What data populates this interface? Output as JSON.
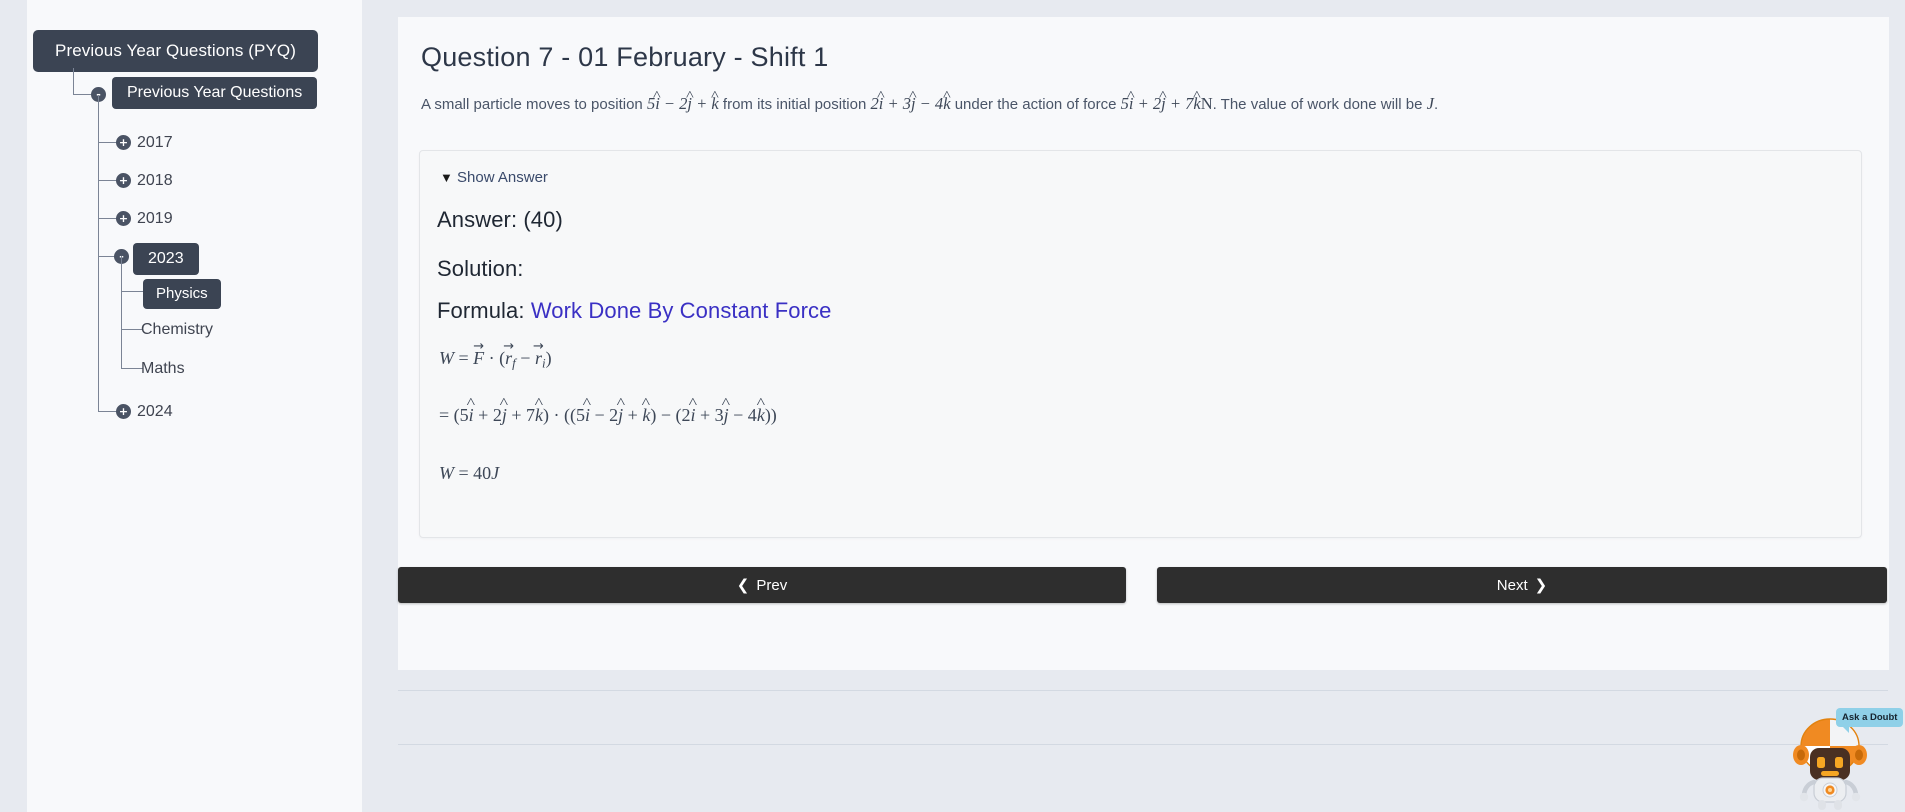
{
  "sidebar": {
    "root": {
      "label": "Previous Year Questions (PYQ)"
    },
    "tree": {
      "label": "Previous Year Questions",
      "toggle": "-",
      "years": [
        {
          "label": "2017",
          "toggle": "+",
          "expanded": false
        },
        {
          "label": "2018",
          "toggle": "+",
          "expanded": false
        },
        {
          "label": "2019",
          "toggle": "+",
          "expanded": false
        },
        {
          "label": "2023",
          "toggle": "-",
          "expanded": true,
          "subjects": [
            {
              "label": "Physics",
              "selected": true
            },
            {
              "label": "Chemistry",
              "selected": false
            },
            {
              "label": "Maths",
              "selected": false
            }
          ]
        },
        {
          "label": "2024",
          "toggle": "+",
          "expanded": false
        }
      ]
    }
  },
  "question": {
    "title": "Question 7 - 01 February - Shift 1",
    "text_plain": "A small particle moves to position 5î − 2ĵ + k̂ from its initial position 2î + 3ĵ − 4k̂ under the action of force 5î + 2ĵ + 7k̂N. The value of work done will be J.",
    "seg1": "A small particle moves to position",
    "seg2": "from its initial position",
    "seg3": "under the action of force",
    "seg4": ". The value of work done will be",
    "seg5": "."
  },
  "answer_card": {
    "show_answer_label": "Show Answer",
    "show_answer_caret": "▼",
    "answer_label": "Answer: (40)",
    "solution_label": "Solution:",
    "formula_prefix": "Formula:",
    "formula_link": "Work Done By Constant Force",
    "formula_link_color": "#3a30c4",
    "equations": [
      "W = F⃗ · (r⃗_f − r⃗_i)",
      "= (5î + 2ĵ + 7k̂) · ((5î − 2ĵ + k̂) − (2î + 3ĵ − 4k̂))",
      "W = 40J"
    ]
  },
  "nav": {
    "prev_label": "Prev",
    "prev_icon": "❮",
    "next_label": "Next",
    "next_icon": "❯"
  },
  "widget": {
    "bubble_text": "Ask a Doubt",
    "bubble_color": "#8fd0e8",
    "name": "ask-a-doubt-robot"
  },
  "colors": {
    "page_bg": "#e7eaf0",
    "panel_bg": "#f8f9fb",
    "node_dark": "#3b4453",
    "button_dark": "#2e2e2e",
    "link": "#3a30c4"
  }
}
